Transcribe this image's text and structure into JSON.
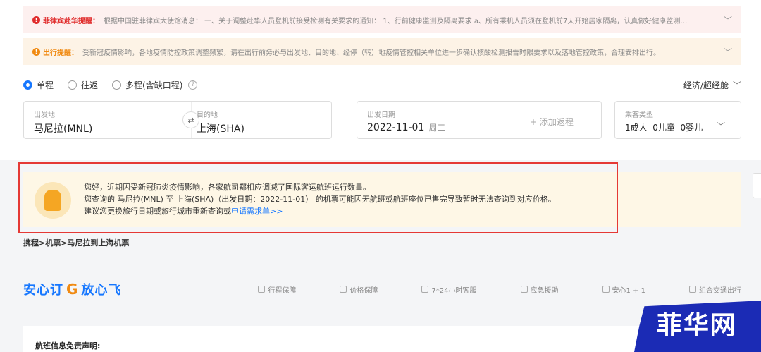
{
  "notices": [
    {
      "title": "菲律宾赴华提醒：",
      "text": "根据中国驻菲律宾大使馆消息： 一、关于调整赴华人员登机前接受检测有关要求的通知： 1、行前健康监测及隔离要求 a、所有乘机人员须在登机前7天开始居家隔离，认真做好健康监测…",
      "color": "#e02d2d"
    },
    {
      "title": "出行提醒：",
      "text": "受新冠疫情影响，各地疫情防控政策调整频繁，请在出行前务必与出发地、目的地、经停（转）地疫情管控相关单位进一步确认核酸检测报告时限要求以及落地管控政策，合理安排出行。",
      "color": "#f08a12"
    }
  ],
  "trip_types": [
    {
      "label": "单程",
      "selected": true
    },
    {
      "label": "往返",
      "selected": false
    },
    {
      "label": "多程(含缺口程)",
      "selected": false
    }
  ],
  "cabin": "经济/超经舱",
  "search": {
    "from_label": "出发地",
    "from_value": "马尼拉(MNL)",
    "to_label": "目的地",
    "to_value": "上海(SHA)",
    "date_label": "出发日期",
    "date_value": "2022-11-01",
    "weekday": "周二",
    "add_return": "+ 添加返程",
    "pax_label": "乘客类型",
    "pax_value": "1成人  0儿童  0婴儿"
  },
  "banner": {
    "line1": "您好，近期因受新冠肺炎疫情影响，各家航司都相应调减了国际客运航班运行数量。",
    "line2": "您查询的 马尼拉(MNL) 至 上海(SHA)（出发日期：2022-11-01） 的机票可能因无航班或航班座位已售完导致暂时无法查询到对应价格。",
    "line3_prefix": "建议您更换旅行日期或旅行城市重新查询或",
    "line3_link": "申请需求单>>"
  },
  "breadcrumb": "携程>机票>马尼拉到上海机票",
  "brand": {
    "left": "安心订",
    "g": "G",
    "right": "放心飞"
  },
  "guarantees": [
    "行程保障",
    "价格保障",
    "7*24小时客服",
    "应急援助",
    "安心1 + 1",
    "组合交通出行"
  ],
  "disclaimer_title": "航班信息免责声明:",
  "watermark": "菲华网"
}
